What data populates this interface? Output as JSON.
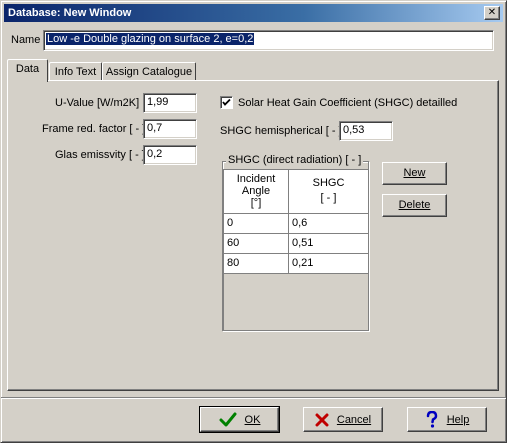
{
  "window": {
    "title": "Database: New Window",
    "close_glyph": "✕"
  },
  "name_field": {
    "label": "Name",
    "value": "Low -e Double glazing on surface 2, e=0,2"
  },
  "tabs": [
    {
      "label": "Data"
    },
    {
      "label": "Info Text"
    },
    {
      "label": "Assign Catalogue"
    }
  ],
  "data_tab": {
    "u_value": {
      "label": "U-Value [W/m2K]",
      "value": "1,99"
    },
    "frame_red_factor": {
      "label": "Frame red. factor [ - ]",
      "value": "0,7"
    },
    "glas_emissivity": {
      "label": "Glas emissvity [ - ]",
      "value": "0,2"
    },
    "shgc_detailled": {
      "label": "Solar Heat Gain Coefficient (SHGC) detailled",
      "checked": true
    },
    "shgc_hemispherical": {
      "label": "SHGC hemispherical [ - ]",
      "value": "0,53"
    },
    "shgc_group": {
      "title": "SHGC (direct radiation) [ - ]",
      "columns": [
        {
          "line1": "Incident",
          "line2": "Angle",
          "line3": "[°]"
        },
        {
          "line1": "SHGC",
          "line2": "[ - ]"
        }
      ],
      "rows": [
        {
          "angle": "0",
          "shgc": "0,6"
        },
        {
          "angle": "60",
          "shgc": "0,51"
        },
        {
          "angle": "80",
          "shgc": "0,21"
        }
      ]
    },
    "new_button": {
      "label": "New"
    },
    "delete_button": {
      "label": "Delete"
    }
  },
  "footer": {
    "ok": {
      "label": "OK",
      "icon": "checkmark-icon",
      "color": "#008000"
    },
    "cancel": {
      "label": "Cancel",
      "icon": "x-icon",
      "color": "#c00000"
    },
    "help": {
      "label": "Help",
      "icon": "question-icon",
      "color": "#0000c0"
    }
  }
}
